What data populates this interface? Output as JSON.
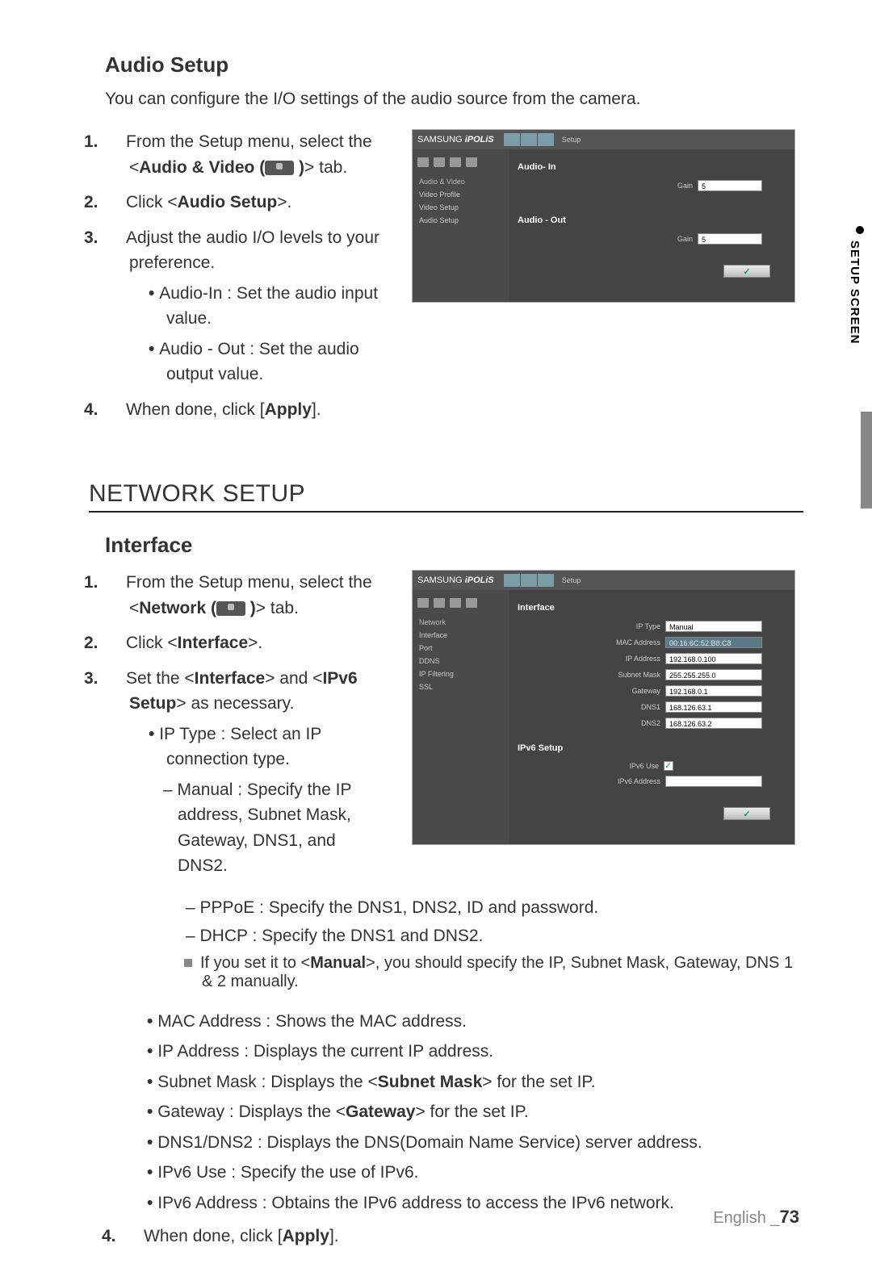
{
  "side_tab": "SETUP SCREEN",
  "audio": {
    "heading": "Audio Setup",
    "intro": "You can configure the I/O settings of the audio source from the camera.",
    "step1_a": "From the Setup menu, select the <",
    "step1_b": "Audio & Video (",
    "step1_c": " )",
    "step1_d": "> tab.",
    "step2_a": "Click <",
    "step2_b": "Audio Setup",
    "step2_c": ">.",
    "step3": "Adjust the audio I/O levels to your preference.",
    "b1": "Audio-In : Set the audio input value.",
    "b2": "Audio - Out : Set the audio output value.",
    "step4_a": "When done, click [",
    "step4_b": "Apply",
    "step4_c": "]."
  },
  "network_heading": "NETWORK SETUP",
  "interface": {
    "heading": "Interface",
    "step1_a": "From the Setup menu, select the <",
    "step1_b": "Network (",
    "step1_c": " )",
    "step1_d": "> tab.",
    "step2_a": "Click <",
    "step2_b": "Interface",
    "step2_c": ">.",
    "step3_a": "Set the <",
    "step3_b": "Interface",
    "step3_c": "> and <",
    "step3_d": "IPv6 Setup",
    "step3_e": "> as necessary.",
    "b_iptype": "IP Type : Select an IP connection type.",
    "s_manual": "Manual : Specify the IP address, Subnet Mask, Gateway, DNS1, and DNS2.",
    "s_pppoe": "PPPoE : Specify the DNS1, DNS2, ID and password.",
    "s_dhcp": "DHCP : Specify the DNS1 and DNS2.",
    "note_a": "If you set it to <",
    "note_b": "Manual",
    "note_c": ">, you should specify the IP, Subnet Mask, Gateway, DNS 1 & 2 manually.",
    "b_mac": "MAC Address : Shows the MAC address.",
    "b_ip": "IP Address : Displays the current IP address.",
    "b_sm_a": "Subnet Mask : Displays the <",
    "b_sm_b": "Subnet Mask",
    "b_sm_c": "> for the set IP.",
    "b_gw_a": "Gateway : Displays the <",
    "b_gw_b": "Gateway",
    "b_gw_c": "> for the set IP.",
    "b_dns": "DNS1/DNS2 : Displays the DNS(Domain Name Service) server address.",
    "b_v6use": "IPv6 Use : Specify the use of IPv6.",
    "b_v6addr": "IPv6 Address : Obtains the IPv6 address to access the IPv6 network.",
    "step4_a": "When done, click [",
    "step4_b": "Apply",
    "step4_c": "]."
  },
  "shot1": {
    "logo_a": "SAMSUNG",
    "logo_b": "iPOLiS",
    "setup": "Setup",
    "menu_head": "Audio & Video",
    "menu": [
      "Video Profile",
      "Video Setup",
      "Audio Setup"
    ],
    "panel1": "Audio- In",
    "panel2": "Audio - Out",
    "gain_lbl": "Gain",
    "gain_val": "5",
    "apply": "✓"
  },
  "shot2": {
    "logo_a": "SAMSUNG",
    "logo_b": "iPOLiS",
    "setup": "Setup",
    "menu_head": "Network",
    "menu": [
      "Interface",
      "Port",
      "DDNS",
      "IP Filtering",
      "SSL"
    ],
    "panel1": "Interface",
    "panel2": "IPv6 Setup",
    "rows": {
      "iptype_lbl": "IP Type",
      "iptype_val": "Manual",
      "mac_lbl": "MAC Address",
      "mac_val": "00:16:6C:52:B8:C8",
      "ip_lbl": "IP Address",
      "ip_val": "192.168.0.100",
      "sm_lbl": "Subnet Mask",
      "sm_val": "255.255.255.0",
      "gw_lbl": "Gateway",
      "gw_val": "192.168.0.1",
      "d1_lbl": "DNS1",
      "d1_val": "168.126.63.1",
      "d2_lbl": "DNS2",
      "d2_val": "168.126.63.2",
      "v6use_lbl": "IPv6 Use",
      "v6addr_lbl": "IPv6 Address",
      "v6addr_val": ""
    },
    "apply": "✓"
  },
  "footer": {
    "lang": "English _",
    "page": "73"
  }
}
